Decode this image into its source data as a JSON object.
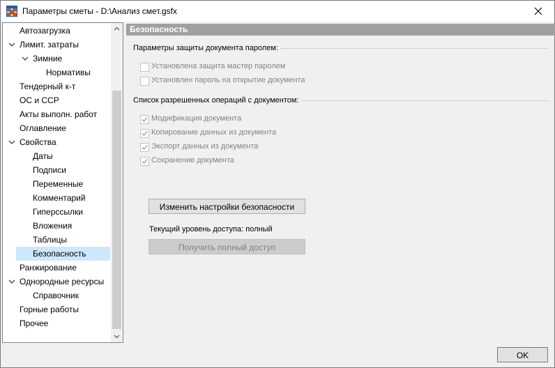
{
  "window": {
    "title": "Параметры сметы - D:\\Анализ смет.gsfx",
    "app_icon": "grid-app-icon",
    "close_icon": "close-icon"
  },
  "tree": {
    "items": [
      {
        "label": "Автозагрузка",
        "level": 0,
        "expander": "none"
      },
      {
        "label": "Лимит. затраты",
        "level": 0,
        "expander": "expanded"
      },
      {
        "label": "Зимние",
        "level": 1,
        "expander": "expanded"
      },
      {
        "label": "Нормативы",
        "level": 2,
        "expander": "none"
      },
      {
        "label": "Тендерный к-т",
        "level": 0,
        "expander": "none"
      },
      {
        "label": "ОС и ССР",
        "level": 0,
        "expander": "none"
      },
      {
        "label": "Акты выполн. работ",
        "level": 0,
        "expander": "none"
      },
      {
        "label": "Оглавление",
        "level": 0,
        "expander": "none"
      },
      {
        "label": "Свойства",
        "level": 0,
        "expander": "expanded"
      },
      {
        "label": "Даты",
        "level": 1,
        "expander": "none"
      },
      {
        "label": "Подписи",
        "level": 1,
        "expander": "none"
      },
      {
        "label": "Переменные",
        "level": 1,
        "expander": "none"
      },
      {
        "label": "Комментарий",
        "level": 1,
        "expander": "none"
      },
      {
        "label": "Гиперссылки",
        "level": 1,
        "expander": "none"
      },
      {
        "label": "Вложения",
        "level": 1,
        "expander": "none"
      },
      {
        "label": "Таблицы",
        "level": 1,
        "expander": "none"
      },
      {
        "label": "Безопасность",
        "level": 1,
        "expander": "none",
        "selected": true
      },
      {
        "label": "Ранжирование",
        "level": 0,
        "expander": "none"
      },
      {
        "label": "Однородные ресурсы",
        "level": 0,
        "expander": "expanded"
      },
      {
        "label": "Справочник",
        "level": 1,
        "expander": "none"
      },
      {
        "label": "Горные работы",
        "level": 0,
        "expander": "none"
      },
      {
        "label": "Прочее",
        "level": 0,
        "expander": "none"
      }
    ]
  },
  "content": {
    "header": "Безопасность",
    "password_group": {
      "title": "Параметры защиты документа паролем:",
      "options": [
        {
          "label": "Установлена защита мастер паролем",
          "checked": false
        },
        {
          "label": "Установлен пароль на открытие документа",
          "checked": false
        }
      ]
    },
    "operations_group": {
      "title": "Список разрешенных операций с документом:",
      "options": [
        {
          "label": "Модификация документа",
          "checked": true
        },
        {
          "label": "Копирование данных из документа",
          "checked": true
        },
        {
          "label": "Экспорт данных из документа",
          "checked": true
        },
        {
          "label": "Сохранение документа",
          "checked": true
        }
      ]
    },
    "change_settings_button": "Изменить настройки безопасности",
    "access_level_text": "Текущий уровень доступа: полный",
    "get_full_access_button": "Получить полный доступ"
  },
  "footer": {
    "ok_button": "OK"
  },
  "colors": {
    "header_bg": "#a0a0a0",
    "selection_bg": "#cce8ff",
    "disabled_text": "#838383"
  }
}
